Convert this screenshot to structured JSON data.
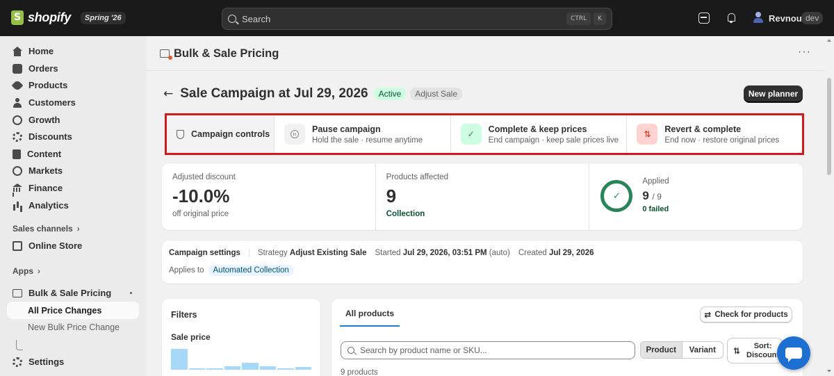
{
  "topbar": {
    "brand": "shopify",
    "release_badge": "Spring '26",
    "search_placeholder": "Search",
    "shortcut_keys": [
      "CTRL",
      "K"
    ],
    "store_name": "Revnous",
    "store_badge": "dev"
  },
  "sidebar": {
    "items": [
      {
        "label": "Home",
        "icon": "home-icon"
      },
      {
        "label": "Orders",
        "icon": "orders-icon"
      },
      {
        "label": "Products",
        "icon": "tag-icon"
      },
      {
        "label": "Customers",
        "icon": "person-icon"
      },
      {
        "label": "Growth",
        "icon": "growth-icon"
      },
      {
        "label": "Discounts",
        "icon": "discount-icon"
      },
      {
        "label": "Content",
        "icon": "content-icon"
      },
      {
        "label": "Markets",
        "icon": "globe-icon"
      },
      {
        "label": "Finance",
        "icon": "bank-icon"
      },
      {
        "label": "Analytics",
        "icon": "bar-chart-icon"
      }
    ],
    "sales_channels_label": "Sales channels",
    "online_store_label": "Online Store",
    "apps_label": "Apps",
    "app_name": "Bulk & Sale Pricing",
    "app_subitems": [
      {
        "label": "All Price Changes",
        "active": true
      },
      {
        "label": "New Bulk Price Change",
        "active": false
      }
    ],
    "settings_label": "Settings"
  },
  "page": {
    "header_title": "Bulk & Sale Pricing",
    "more_label": "···",
    "campaign_title": "Sale Campaign at Jul 29, 2026",
    "status_badge": "Active",
    "type_badge": "Adjust Sale",
    "new_planner_label": "New planner"
  },
  "controls": {
    "title": "Campaign controls",
    "options": [
      {
        "title": "Pause campaign",
        "subtitle": "Hold the sale · resume anytime",
        "icon": "pause-icon"
      },
      {
        "title": "Complete & keep prices",
        "subtitle": "End campaign · keep sale prices live",
        "icon": "check-icon",
        "glyph": "✓",
        "color": "#29845a"
      },
      {
        "title": "Revert & complete",
        "subtitle": "End now · restore original prices",
        "icon": "revert-icon",
        "glyph": "⇅",
        "color": "#e51c00"
      }
    ]
  },
  "stats": {
    "discount_label": "Adjusted discount",
    "discount_value": "-10.0%",
    "discount_sub": "off original price",
    "affected_label": "Products affected",
    "affected_value": "9",
    "affected_link": "Collection",
    "applied_label": "Applied",
    "applied_value": "9",
    "applied_total": "/ 9",
    "applied_failed": "0 failed",
    "applied_ring_glyph": "✓",
    "applied_fraction": 1.0
  },
  "settings": {
    "title": "Campaign settings",
    "strategy_label": "Strategy",
    "strategy_value": "Adjust Existing Sale",
    "started_label": "Started",
    "started_value": "Jul 29, 2026, 03:51 PM",
    "started_note": "(auto)",
    "created_label": "Created",
    "created_value": "Jul 29, 2026",
    "applies_label": "Applies to",
    "applies_value": "Automated Collection"
  },
  "filters": {
    "title": "Filters",
    "sale_price_label": "Sale price",
    "histogram": [
      0.95,
      0.05,
      0.05,
      0.15,
      0.3,
      0.15,
      0.05,
      0.12
    ]
  },
  "products": {
    "tab_label": "All products",
    "check_label": "Check for products",
    "check_icon_glyph": "⇄",
    "search_placeholder": "Search by product name or SKU...",
    "segment": [
      "Product",
      "Variant"
    ],
    "sort_label": "Sort: Discount",
    "sort_icon_glyph": "⇅",
    "count_label": "9 products"
  },
  "colors": {
    "accent_green": "#29845a",
    "badge_active_bg": "#cdfee1",
    "highlight_box": "#d0191d",
    "chat_fab": "#1d6fd1"
  }
}
